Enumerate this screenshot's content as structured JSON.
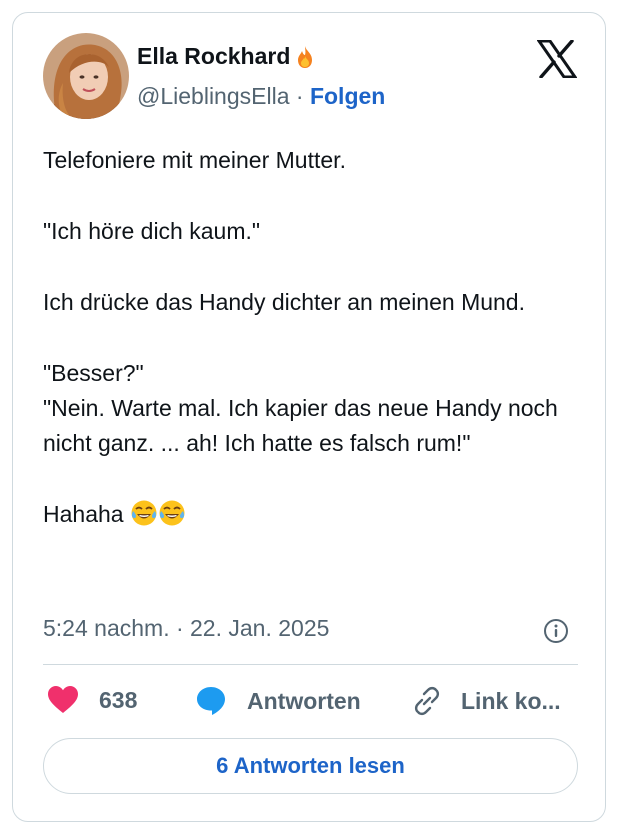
{
  "author": {
    "display_name": "Ella Rockhard",
    "handle": "@LieblingsElla",
    "separator": "·",
    "follow_label": "Folgen"
  },
  "tweet": {
    "lines": [
      "Telefoniere mit meiner Mutter.",
      "\"Ich höre dich kaum.\"",
      "Ich drücke das Handy dichter an meinen Mund.",
      "\"Besser?\"",
      "\"Nein. Warte mal. Ich kapier das neue Handy noch nicht ganz. ... ah! Ich hatte es falsch rum!\"",
      "Hahaha"
    ],
    "timestamp": "5:24 nachm. · 22. Jan. 2025"
  },
  "actions": {
    "like_count": "638",
    "reply_label": "Antworten",
    "link_label": "Link ko..."
  },
  "read_replies_label": "6 Antworten lesen",
  "colors": {
    "link_blue": "#1d64c8",
    "muted_text": "#536471",
    "heart": "#f0306c",
    "reply_bubble": "#1d9bf0",
    "border": "#cfd9de"
  },
  "icons": [
    "flame-icon",
    "x-logo-icon",
    "info-icon",
    "heart-icon",
    "reply-bubble-icon",
    "link-icon",
    "tears-of-joy-emoji"
  ]
}
